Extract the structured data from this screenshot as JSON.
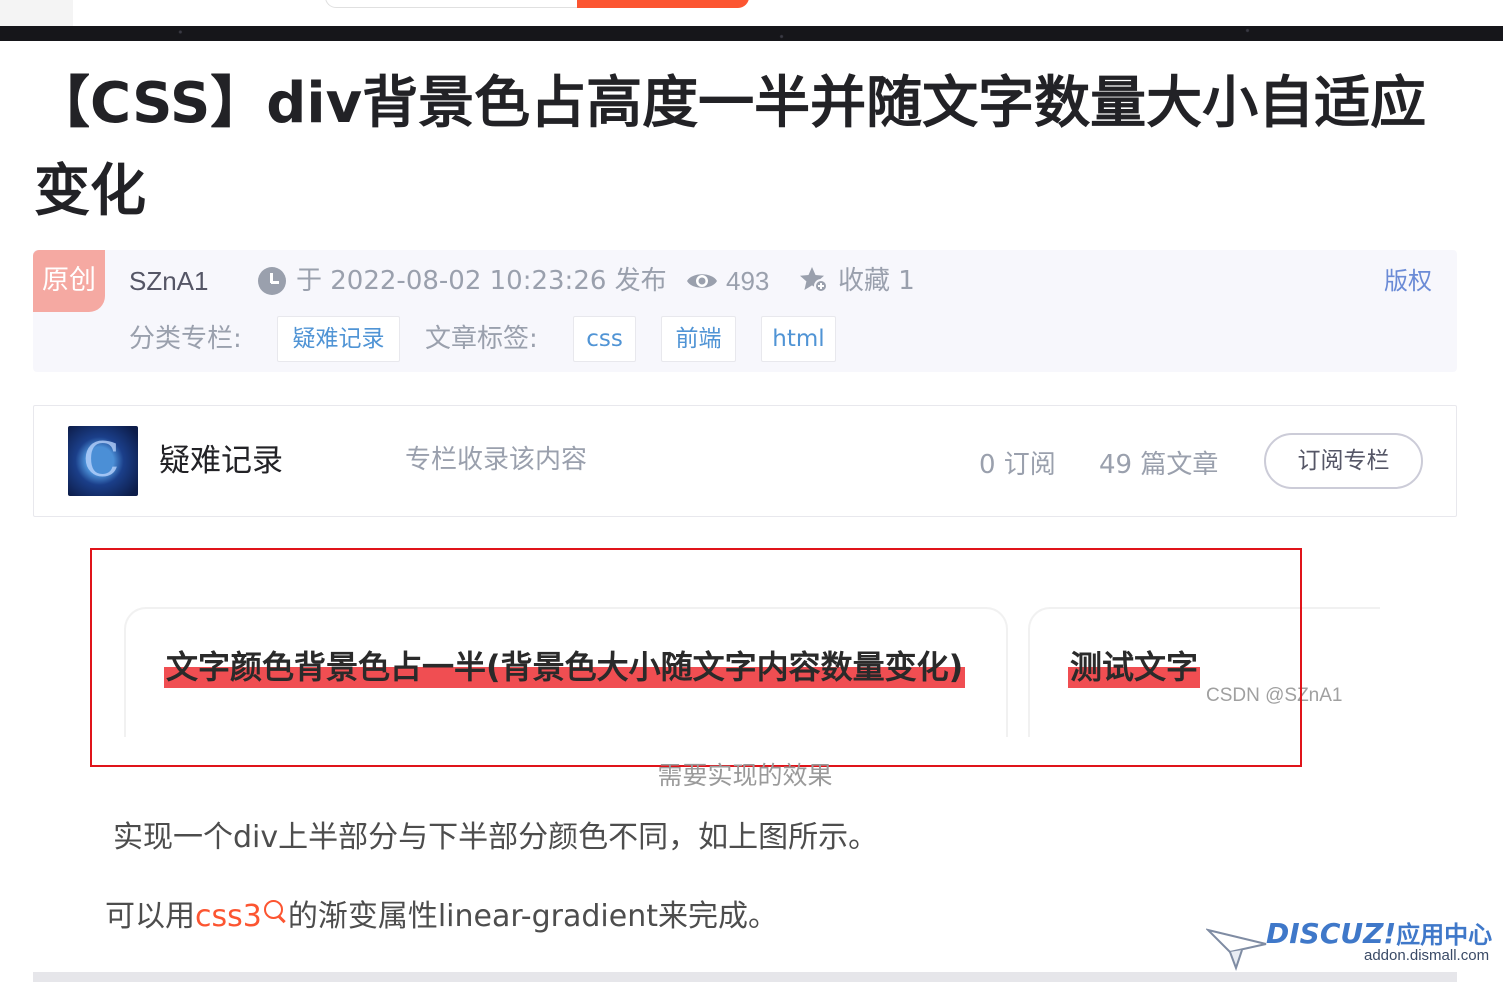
{
  "article": {
    "title": "【CSS】div背景色占高度一半并随文字数量大小自适应变化"
  },
  "meta": {
    "badge": "原创",
    "author": "SZnA1",
    "publish_time": "于 2022-08-02 10:23:26 发布",
    "views": "493",
    "collect": "收藏 1",
    "copyright": "版权",
    "category_label": "分类专栏:",
    "category": "疑难记录",
    "tags_label": "文章标签:",
    "tags": [
      "css",
      "前端",
      "html"
    ]
  },
  "column": {
    "avatar_letter": "C",
    "name": "疑难记录",
    "note": "专栏收录该内容",
    "subscribers": "0 订阅",
    "articles": "49 篇文章",
    "subscribe_label": "订阅专栏"
  },
  "figure": {
    "text1": "文字颜色背景色占一半(背景色大小随文字内容数量变化)",
    "text2": "测试文字",
    "watermark": "CSDN @SZnA1",
    "caption": "需要实现的效果"
  },
  "body": {
    "para1": "实现一个div上半部分与下半部分颜色不同，如上图所示。",
    "para2_before": "可以用",
    "para2_keyword": "css3",
    "para2_after": "的渐变属性linear-gradient来完成。"
  },
  "overlay": {
    "brand": "DISCUZ!",
    "brand_cn": "应用中心",
    "site": "addon.dismall.com"
  },
  "colors": {
    "accent": "#fc5531",
    "link": "#5094d5",
    "highlight": "#f04e52",
    "frame": "#e0141a"
  }
}
